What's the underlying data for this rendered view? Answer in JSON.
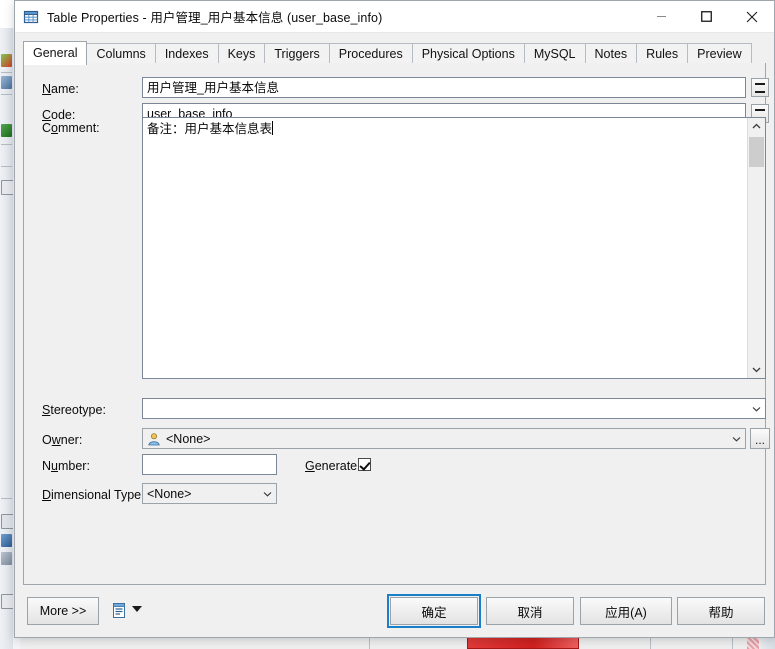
{
  "window": {
    "title": "Table Properties - 用户管理_用户基本信息 (user_base_info)",
    "icon": "table-icon",
    "controls": {
      "minimize": "minimize-icon",
      "maximize": "maximize-icon",
      "close": "close-icon"
    }
  },
  "tabs": [
    {
      "label": "General",
      "active": true
    },
    {
      "label": "Columns",
      "active": false
    },
    {
      "label": "Indexes",
      "active": false
    },
    {
      "label": "Keys",
      "active": false
    },
    {
      "label": "Triggers",
      "active": false
    },
    {
      "label": "Procedures",
      "active": false
    },
    {
      "label": "Physical Options",
      "active": false
    },
    {
      "label": "MySQL",
      "active": false
    },
    {
      "label": "Notes",
      "active": false
    },
    {
      "label": "Rules",
      "active": false
    },
    {
      "label": "Preview",
      "active": false
    }
  ],
  "general": {
    "name": {
      "label_prefix": "",
      "label_mnemonic": "N",
      "label_suffix": "ame:",
      "value": "用户管理_用户基本信息",
      "equals_button": "="
    },
    "code": {
      "label_prefix": "",
      "label_mnemonic": "C",
      "label_suffix": "ode:",
      "value": "user_base_info",
      "equals_button": "="
    },
    "comment": {
      "label_prefix": "C",
      "label_mnemonic": "o",
      "label_suffix": "mment:",
      "value": "备注：用户基本信息表"
    },
    "stereotype": {
      "label_prefix": "",
      "label_mnemonic": "S",
      "label_suffix": "tereotype:",
      "value": ""
    },
    "owner": {
      "label_prefix": "O",
      "label_mnemonic": "w",
      "label_suffix": "ner:",
      "value": "<None>",
      "icon": "user-icon",
      "browse_button": "..."
    },
    "number": {
      "label_prefix": "N",
      "label_mnemonic": "u",
      "label_suffix": "mber:",
      "value": ""
    },
    "generate": {
      "label_prefix": "",
      "label_mnemonic": "G",
      "label_suffix": "enerate:",
      "checked": true
    },
    "dimensional_type": {
      "label_prefix": "",
      "label_mnemonic": "D",
      "label_suffix": "imensional Type:",
      "value": "<None>",
      "options": [
        "<None>"
      ]
    }
  },
  "footer": {
    "more": "More >>",
    "report_icon": "report-icon",
    "report_dropdown": "chevron-down-icon",
    "ok": "确定",
    "cancel": "取消",
    "apply": "应用(A)",
    "help": "帮助"
  },
  "colors": {
    "accent": "#1a7ec8",
    "dialog_bg": "#f0f0f0",
    "field_bg": "#ffffff",
    "border": "#7b8794",
    "background_red": "#d02020"
  }
}
